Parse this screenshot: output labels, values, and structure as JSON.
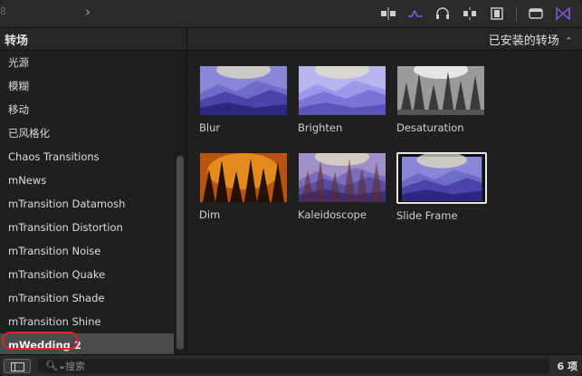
{
  "toolbar": {
    "left_digit": "8",
    "icons": [
      "split-clip-icon",
      "audio-waveform-icon",
      "headphones-icon",
      "snap-icon",
      "filmstrip-icon",
      "window-icon",
      "transition-icon"
    ],
    "accent": "#8a5cf5"
  },
  "sidebar": {
    "title": "转场",
    "items": [
      {
        "label": "光源"
      },
      {
        "label": "模糊"
      },
      {
        "label": "移动"
      },
      {
        "label": "已风格化"
      },
      {
        "label": "Chaos Transitions"
      },
      {
        "label": "mNews"
      },
      {
        "label": "mTransition Datamosh"
      },
      {
        "label": "mTransition Distortion"
      },
      {
        "label": "mTransition Noise"
      },
      {
        "label": "mTransition Quake"
      },
      {
        "label": "mTransition Shade"
      },
      {
        "label": "mTransition Shine"
      },
      {
        "label": "mWedding 2"
      }
    ],
    "selected_index": 12
  },
  "browser": {
    "filter_label": "已安装的转场",
    "tiles": [
      {
        "label": "Blur",
        "style": "blur"
      },
      {
        "label": "Brighten",
        "style": "brighten"
      },
      {
        "label": "Desaturation",
        "style": "desaturation"
      },
      {
        "label": "Dim",
        "style": "dim"
      },
      {
        "label": "Kaleidoscope",
        "style": "kaleidoscope"
      },
      {
        "label": "Slide Frame",
        "style": "slideframe"
      }
    ],
    "selected_tile": "Slide Frame"
  },
  "bottombar": {
    "search_placeholder": "搜索",
    "count": "6 项"
  }
}
